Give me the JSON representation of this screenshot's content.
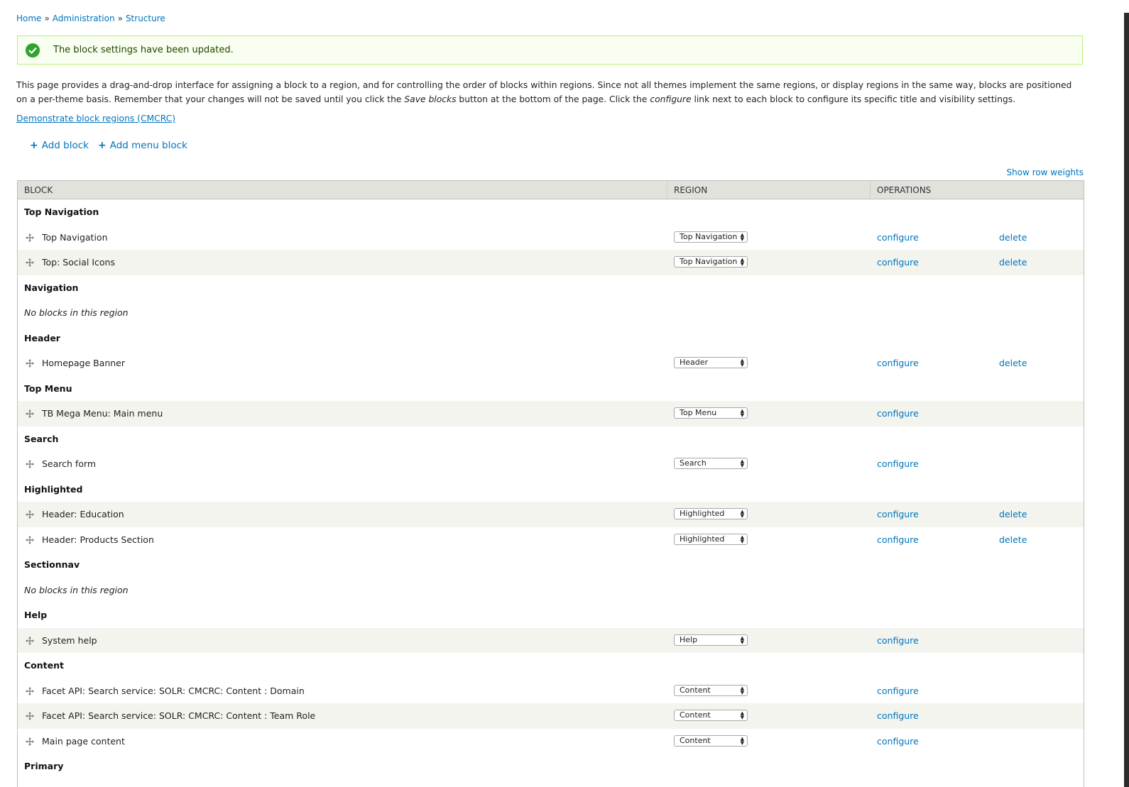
{
  "breadcrumb": {
    "items": [
      "Home",
      "Administration",
      "Structure"
    ],
    "separator": "»"
  },
  "status": {
    "message": "The block settings have been updated."
  },
  "help": {
    "part1": "This page provides a drag-and-drop interface for assigning a block to a region, and for controlling the order of blocks within regions. Since not all themes implement the same regions, or display regions in the same way, blocks are positioned on a per-theme basis. Remember that your changes will not be saved until you click the ",
    "em1": "Save blocks",
    "part2": " button at the bottom of the page. Click the ",
    "em2": "configure",
    "part3": " link next to each block to configure its specific title and visibility settings."
  },
  "demo_link": "Demonstrate block regions (CMCRC)",
  "actions": {
    "add_block": "Add block",
    "add_menu_block": "Add menu block",
    "plus": "+"
  },
  "show_row_weights": "Show row weights",
  "table": {
    "headers": [
      "BLOCK",
      "REGION",
      "OPERATIONS"
    ],
    "configure_label": "configure",
    "delete_label": "delete",
    "empty_label": "No blocks in this region",
    "rows": [
      {
        "kind": "region",
        "label": "Top Navigation"
      },
      {
        "kind": "block",
        "name": "Top Navigation",
        "region": "Top Navigation",
        "delete": true,
        "odd": false
      },
      {
        "kind": "block",
        "name": "Top: Social Icons",
        "region": "Top Navigation",
        "delete": true,
        "odd": true
      },
      {
        "kind": "region",
        "label": "Navigation"
      },
      {
        "kind": "empty"
      },
      {
        "kind": "region",
        "label": "Header"
      },
      {
        "kind": "block",
        "name": "Homepage Banner",
        "region": "Header",
        "delete": true,
        "odd": false
      },
      {
        "kind": "region",
        "label": "Top Menu"
      },
      {
        "kind": "block",
        "name": "TB Mega Menu: Main menu",
        "region": "Top Menu",
        "delete": false,
        "odd": true
      },
      {
        "kind": "region",
        "label": "Search"
      },
      {
        "kind": "block",
        "name": "Search form",
        "region": "Search",
        "delete": false,
        "odd": false
      },
      {
        "kind": "region",
        "label": "Highlighted"
      },
      {
        "kind": "block",
        "name": "Header: Education",
        "region": "Highlighted",
        "delete": true,
        "odd": true
      },
      {
        "kind": "block",
        "name": "Header: Products Section",
        "region": "Highlighted",
        "delete": true,
        "odd": false
      },
      {
        "kind": "region",
        "label": "Sectionnav"
      },
      {
        "kind": "empty"
      },
      {
        "kind": "region",
        "label": "Help"
      },
      {
        "kind": "block",
        "name": "System help",
        "region": "Help",
        "delete": false,
        "odd": true
      },
      {
        "kind": "region",
        "label": "Content"
      },
      {
        "kind": "block",
        "name": "Facet API: Search service: SOLR: CMCRC: Content : Domain",
        "region": "Content",
        "delete": false,
        "odd": false
      },
      {
        "kind": "block",
        "name": "Facet API: Search service: SOLR: CMCRC: Content : Team Role",
        "region": "Content",
        "delete": false,
        "odd": true
      },
      {
        "kind": "block",
        "name": "Main page content",
        "region": "Content",
        "delete": false,
        "odd": false
      },
      {
        "kind": "region",
        "label": "Primary"
      }
    ]
  }
}
